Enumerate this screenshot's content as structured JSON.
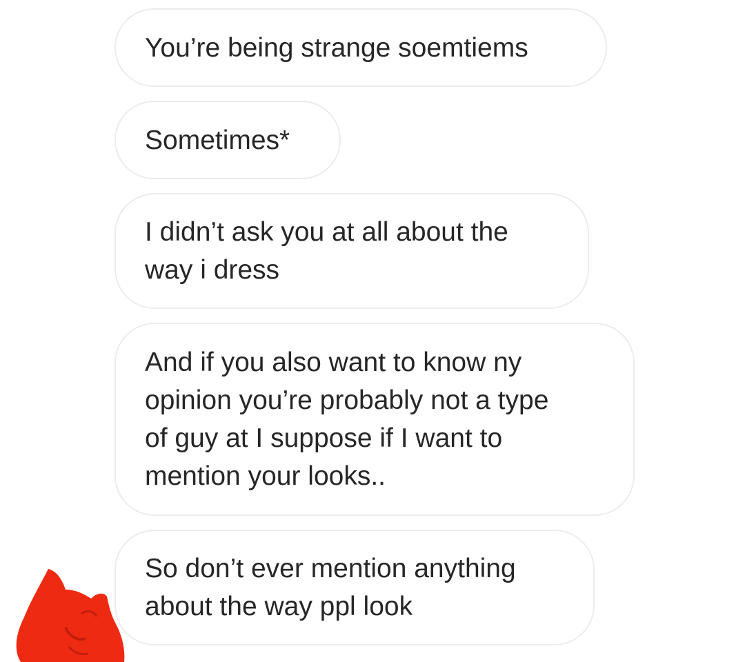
{
  "messages": [
    {
      "text": "You’re being strange soemtiems"
    },
    {
      "text": "Sometimes*"
    },
    {
      "text": "I didn’t ask you at all about the\nway i dress"
    },
    {
      "text": "And if you also want to know ny\nopinion you’re probably not a type\nof guy at I suppose if I want to\nmention your looks.."
    },
    {
      "text": "So don’t ever mention anything\nabout the way ppl look"
    }
  ],
  "colors": {
    "bubble_border": "#ececec",
    "text": "#262626",
    "redaction": "#ee2a12"
  }
}
